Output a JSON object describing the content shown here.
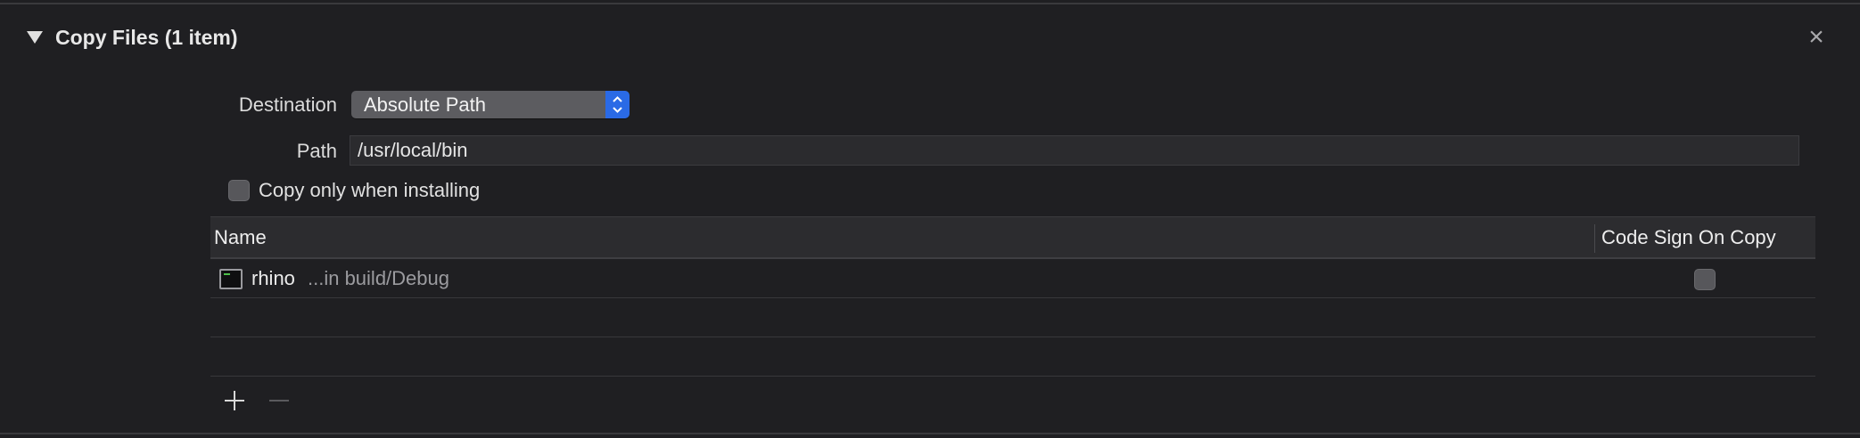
{
  "section": {
    "title": "Copy Files (1 item)",
    "close_glyph": "×",
    "disclosure_icon": "disclosure-triangle-down",
    "close_icon": "close-x"
  },
  "form": {
    "destination_label": "Destination",
    "destination_value": "Absolute Path",
    "path_label": "Path",
    "path_value": "/usr/local/bin",
    "copy_only_label": "Copy only when installing",
    "copy_only_checked": false
  },
  "table": {
    "columns": [
      "Name",
      "Code Sign On Copy"
    ],
    "rows": [
      {
        "icon": "executable-file-icon",
        "name": "rhino",
        "location": "...in build/Debug",
        "code_sign": false
      }
    ]
  },
  "toolbar": {
    "add_icon": "plus",
    "remove_icon": "minus",
    "remove_enabled": false
  },
  "colors": {
    "background": "#1f1f22",
    "accent": "#2a6ae6",
    "header_bg": "#2c2c2f"
  }
}
